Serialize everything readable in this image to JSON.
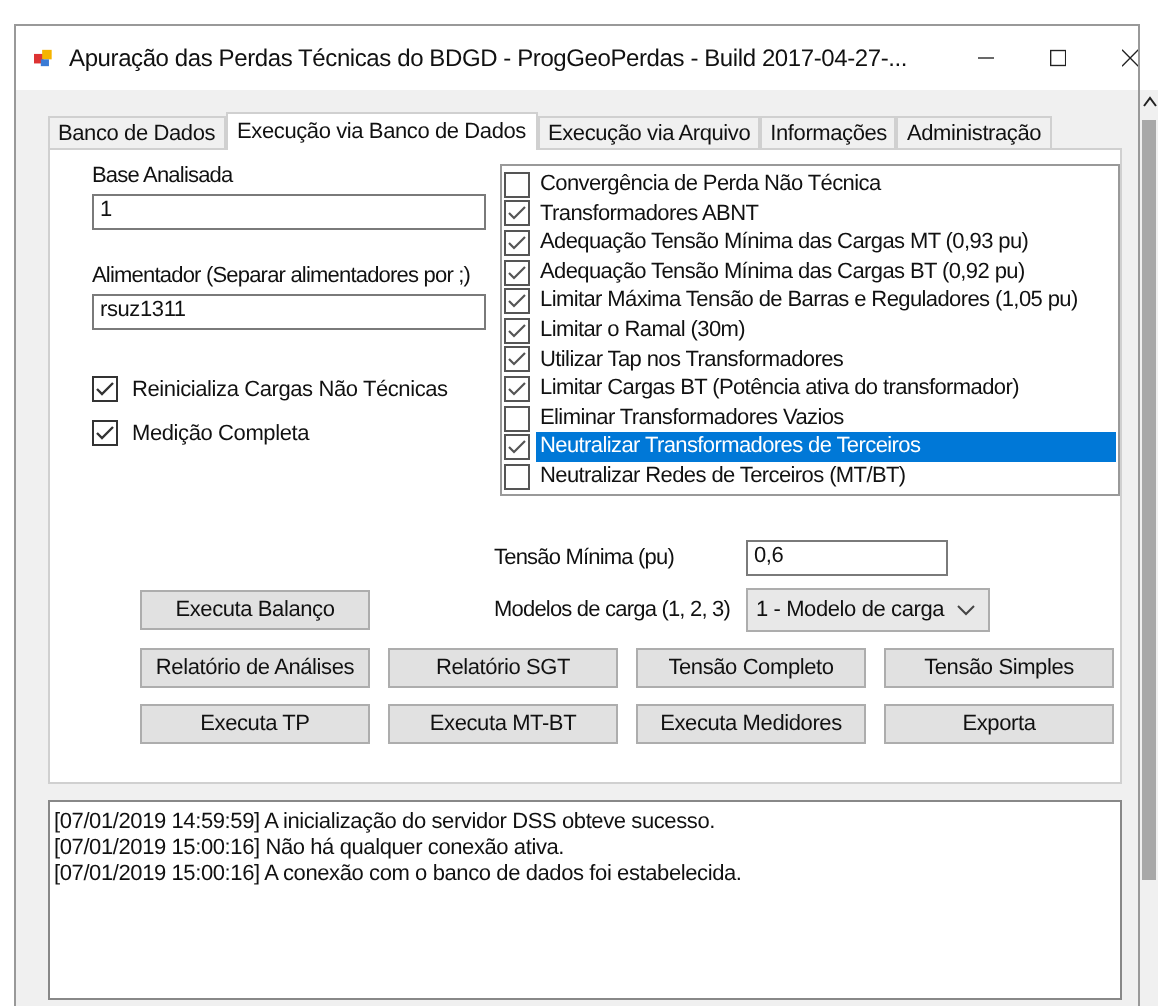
{
  "window": {
    "title": "Apuração das Perdas Técnicas do BDGD - ProgGeoPerdas - Build 2017-04-27-..."
  },
  "tabs": [
    {
      "label": "Banco de Dados",
      "selected": false
    },
    {
      "label": "Execução via Banco de Dados",
      "selected": true
    },
    {
      "label": "Execução via Arquivo",
      "selected": false
    },
    {
      "label": "Informações",
      "selected": false
    },
    {
      "label": "Administração",
      "selected": false
    }
  ],
  "base": {
    "label": "Base Analisada",
    "value": "1"
  },
  "alimentador": {
    "label": "Alimentador (Separar alimentadores por ;)",
    "value": "rsuz1311"
  },
  "checkboxes": [
    {
      "label": "Reinicializa Cargas Não Técnicas",
      "checked": true
    },
    {
      "label": "Medição Completa",
      "checked": true
    }
  ],
  "options": [
    {
      "label": "Convergência de Perda Não Técnica",
      "checked": false,
      "selected": false
    },
    {
      "label": "Transformadores ABNT",
      "checked": true,
      "selected": false
    },
    {
      "label": "Adequação Tensão Mínima das Cargas MT (0,93 pu)",
      "checked": true,
      "selected": false
    },
    {
      "label": "Adequação Tensão Mínima das Cargas BT (0,92 pu)",
      "checked": true,
      "selected": false
    },
    {
      "label": "Limitar Máxima Tensão de Barras e Reguladores (1,05 pu)",
      "checked": true,
      "selected": false
    },
    {
      "label": "Limitar o Ramal (30m)",
      "checked": true,
      "selected": false
    },
    {
      "label": "Utilizar Tap nos Transformadores",
      "checked": true,
      "selected": false
    },
    {
      "label": "Limitar Cargas BT (Potência ativa do transformador)",
      "checked": true,
      "selected": false
    },
    {
      "label": "Eliminar Transformadores Vazios",
      "checked": false,
      "selected": false
    },
    {
      "label": "Neutralizar Transformadores de Terceiros",
      "checked": true,
      "selected": true
    },
    {
      "label": "Neutralizar Redes de Terceiros (MT/BT)",
      "checked": false,
      "selected": false
    }
  ],
  "tensao_minima": {
    "label": "Tensão Mínima (pu)",
    "value": "0,6"
  },
  "modelos": {
    "label": "Modelos de carga (1, 2, 3)",
    "value": "1 - Modelo de carga"
  },
  "balanco_button": "Executa Balanço",
  "buttons": [
    "Relatório de Análises",
    "Relatório SGT",
    "Tensão Completo",
    "Tensão Simples",
    "Executa TP",
    "Executa MT-BT",
    "Executa Medidores",
    "Exporta"
  ],
  "log": [
    "[07/01/2019 14:59:59] A inicialização do servidor DSS obteve sucesso.",
    "[07/01/2019 15:00:16] Não há qualquer conexão ativa.",
    "[07/01/2019 15:00:16] A conexão com o banco de dados foi estabelecida."
  ]
}
